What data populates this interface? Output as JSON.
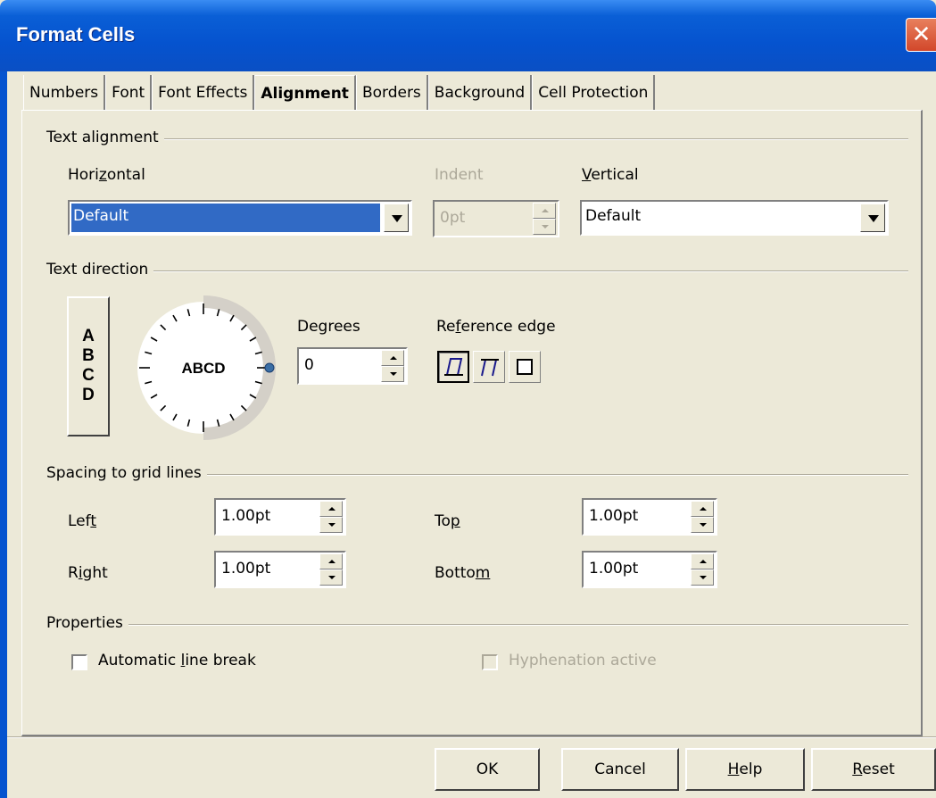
{
  "window": {
    "title": "Format Cells",
    "close_glyph": "✕"
  },
  "tabs": [
    "Numbers",
    "Font",
    "Font Effects",
    "Alignment",
    "Borders",
    "Background",
    "Cell Protection"
  ],
  "active_tab": "Alignment",
  "text_alignment": {
    "section": "Text alignment",
    "horizontal_label": "Horizontal",
    "horizontal_value": "Default",
    "indent_label": "Indent",
    "indent_value": "0pt",
    "vertical_label": "Vertical",
    "vertical_value": "Default"
  },
  "text_direction": {
    "section": "Text direction",
    "stacked_text": "ABCD",
    "dial_text": "ABCD",
    "degrees_label": "Degrees",
    "degrees_value": "0",
    "reference_edge_label": "Reference edge"
  },
  "spacing": {
    "section": "Spacing to grid lines",
    "left_label": "Left",
    "left_value": "1.00pt",
    "right_label": "Right",
    "right_value": "1.00pt",
    "top_label": "Top",
    "top_value": "1.00pt",
    "bottom_label": "Bottom",
    "bottom_value": "1.00pt"
  },
  "properties": {
    "section": "Properties",
    "auto_line_break": "Automatic line break",
    "hyphenation": "Hyphenation active"
  },
  "buttons": {
    "ok": "OK",
    "cancel": "Cancel",
    "help": "Help",
    "reset": "Reset"
  },
  "colors": {
    "title_bar": "#0553cf",
    "selection": "#316ac5",
    "dialog_bg": "#ece9d8"
  }
}
